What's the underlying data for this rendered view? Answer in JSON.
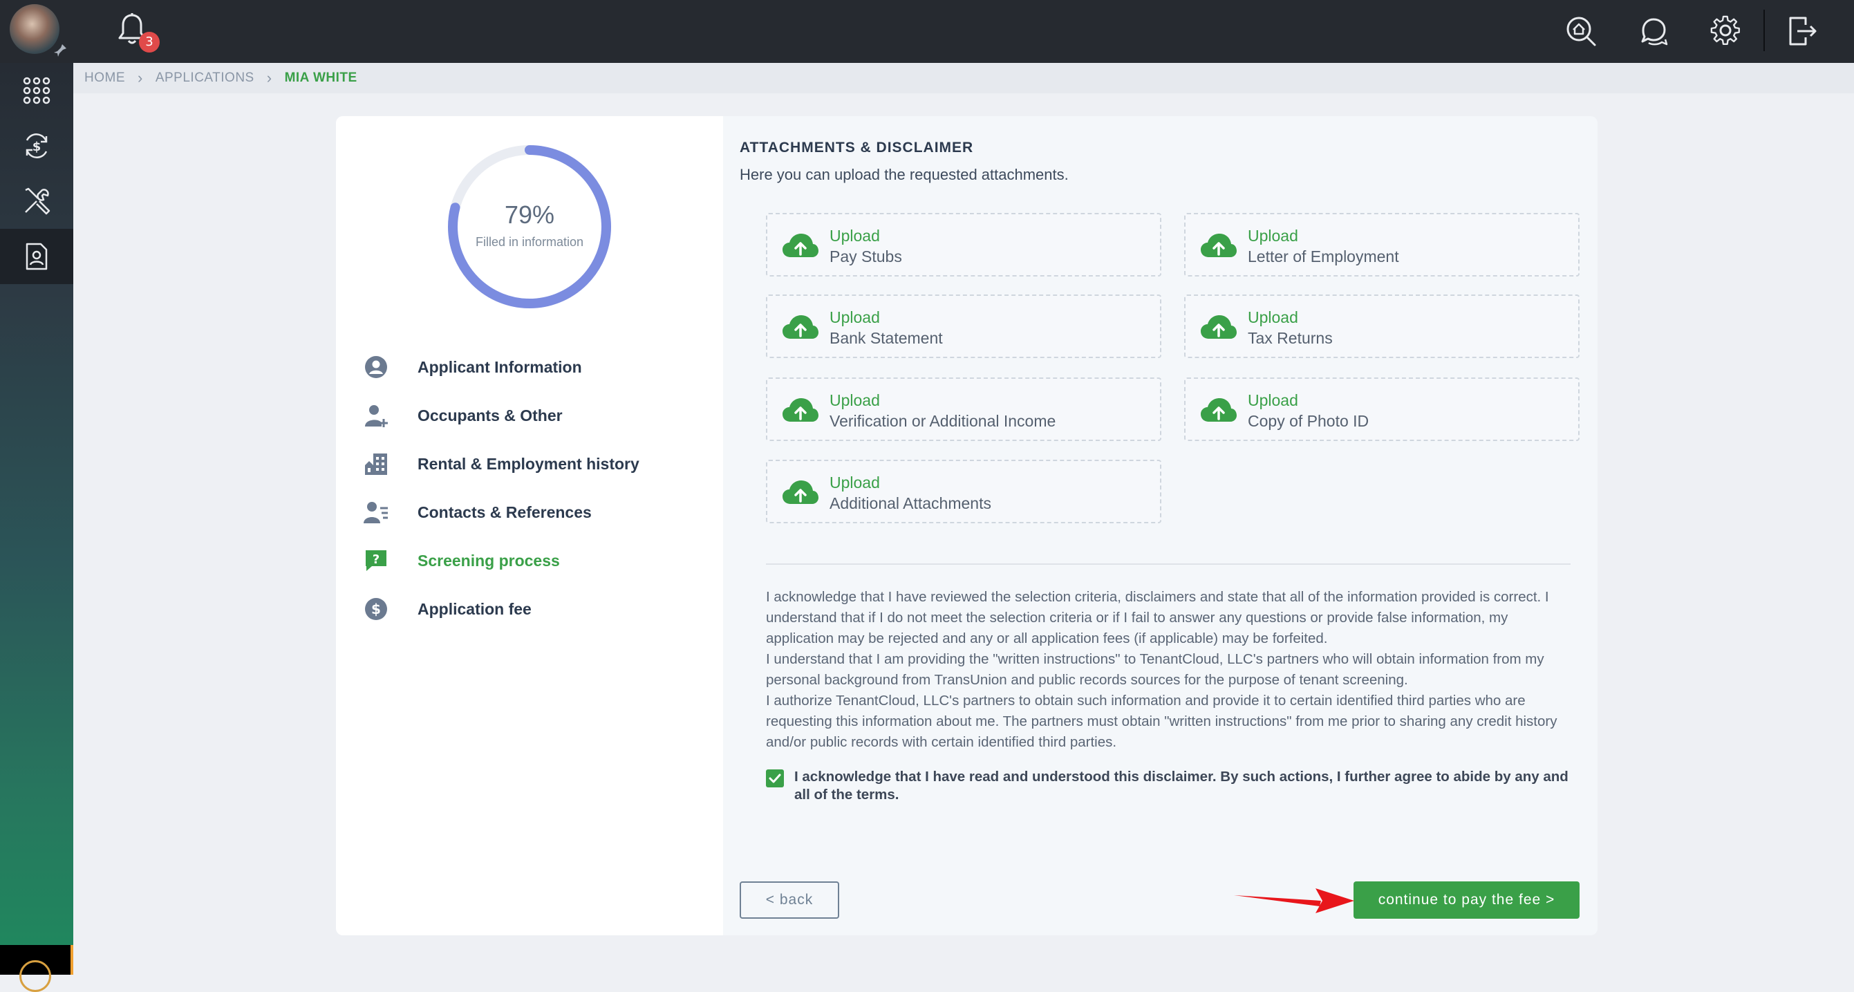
{
  "notifications": {
    "count": "3"
  },
  "breadcrumb": {
    "home": "HOME",
    "applications": "APPLICATIONS",
    "current": "MIA WHITE"
  },
  "progress": {
    "percent_label": "79%",
    "percent": 79,
    "label": "Filled in information"
  },
  "steps": [
    {
      "label": "Applicant Information",
      "icon": "user-circle-icon"
    },
    {
      "label": "Occupants & Other",
      "icon": "user-plus-icon"
    },
    {
      "label": "Rental & Employment history",
      "icon": "building-icon"
    },
    {
      "label": "Contacts & References",
      "icon": "user-list-icon"
    },
    {
      "label": "Screening process",
      "icon": "question-bubble-icon",
      "active": true
    },
    {
      "label": "Application fee",
      "icon": "dollar-circle-icon"
    }
  ],
  "section": {
    "title": "ATTACHMENTS & DISCLAIMER",
    "subtitle": "Here you can upload the requested attachments."
  },
  "uploads": [
    {
      "action": "Upload",
      "name": "Pay Stubs"
    },
    {
      "action": "Upload",
      "name": "Letter of Employment"
    },
    {
      "action": "Upload",
      "name": "Bank Statement"
    },
    {
      "action": "Upload",
      "name": "Tax Returns"
    },
    {
      "action": "Upload",
      "name": "Verification or Additional Income"
    },
    {
      "action": "Upload",
      "name": "Copy of Photo ID"
    },
    {
      "action": "Upload",
      "name": "Additional Attachments"
    }
  ],
  "disclaimer": {
    "p1": "I acknowledge that I have reviewed the selection criteria, disclaimers and state that all of the information provided is correct. I understand that if I do not meet the selection criteria or if I fail to answer any questions or provide false information, my application may be rejected and any or all application fees (if applicable) may be forfeited.",
    "p2": "I understand that I am providing the \"written instructions\" to TenantCloud, LLC's partners who will obtain information from my personal background from TransUnion and public records sources for the purpose of tenant screening.",
    "p3": "I authorize TenantCloud, LLC's partners to obtain such information and provide it to certain identified third parties who are requesting this information about me. The partners must obtain \"written instructions\" from me prior to sharing any credit history and/or public records with certain identified third parties.",
    "ack": "I acknowledge that I have read and understood this disclaimer. By such actions, I further agree to abide by any and all of the terms.",
    "ack_checked": true
  },
  "buttons": {
    "back": "< back",
    "continue": "continue to pay the fee >"
  },
  "colors": {
    "accent": "#3aa048",
    "progress": "#7b8ce0",
    "topbar": "#262a30",
    "badge": "#e04a4a",
    "annotation_arrow": "#e8161b"
  }
}
